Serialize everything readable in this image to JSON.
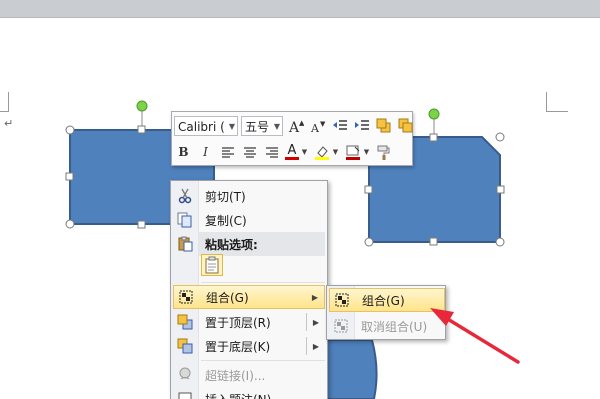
{
  "formatting_toolbar": {
    "font_name": "Calibri (正",
    "font_size": "五号",
    "grow_font_icon": "grow-font-icon",
    "shrink_font_icon": "shrink-font-icon",
    "bold": "B",
    "italic": "I",
    "font_color_letter": "A",
    "font_color": "#d00000",
    "highlight_color": "#ffff00",
    "fill_color": "#c00000"
  },
  "context_menu": {
    "items": [
      {
        "label": "剪切(T)",
        "icon": "scissors-icon",
        "enabled": true
      },
      {
        "label": "复制(C)",
        "icon": "copy-icon",
        "enabled": true
      },
      {
        "label": "粘贴选项:",
        "icon": "paste-icon",
        "enabled": true
      },
      {
        "label": "组合(G)",
        "icon": "group-icon",
        "enabled": true,
        "highlighted": true,
        "has_submenu": true
      },
      {
        "label": "置于顶层(R)",
        "icon": "bring-to-front-icon",
        "enabled": true,
        "has_submenu": true
      },
      {
        "label": "置于底层(K)",
        "icon": "send-to-back-icon",
        "enabled": true,
        "has_submenu": true
      },
      {
        "label": "超链接(I)...",
        "icon": "hyperlink-icon",
        "enabled": false
      },
      {
        "label": "插入题注(N)...",
        "icon": "insert-caption-icon",
        "enabled": true
      }
    ]
  },
  "group_submenu": {
    "items": [
      {
        "label": "组合(G)",
        "icon": "group-icon",
        "enabled": true,
        "highlighted": true
      },
      {
        "label": "取消组合(U)",
        "icon": "ungroup-icon",
        "enabled": false
      }
    ]
  },
  "colors": {
    "shape_fill": "#4f81bd",
    "shape_stroke": "#385d8a",
    "handle_green": "#7cd34a",
    "annotation_arrow": "#e8283a",
    "menu_highlight": "#ffe48a"
  }
}
